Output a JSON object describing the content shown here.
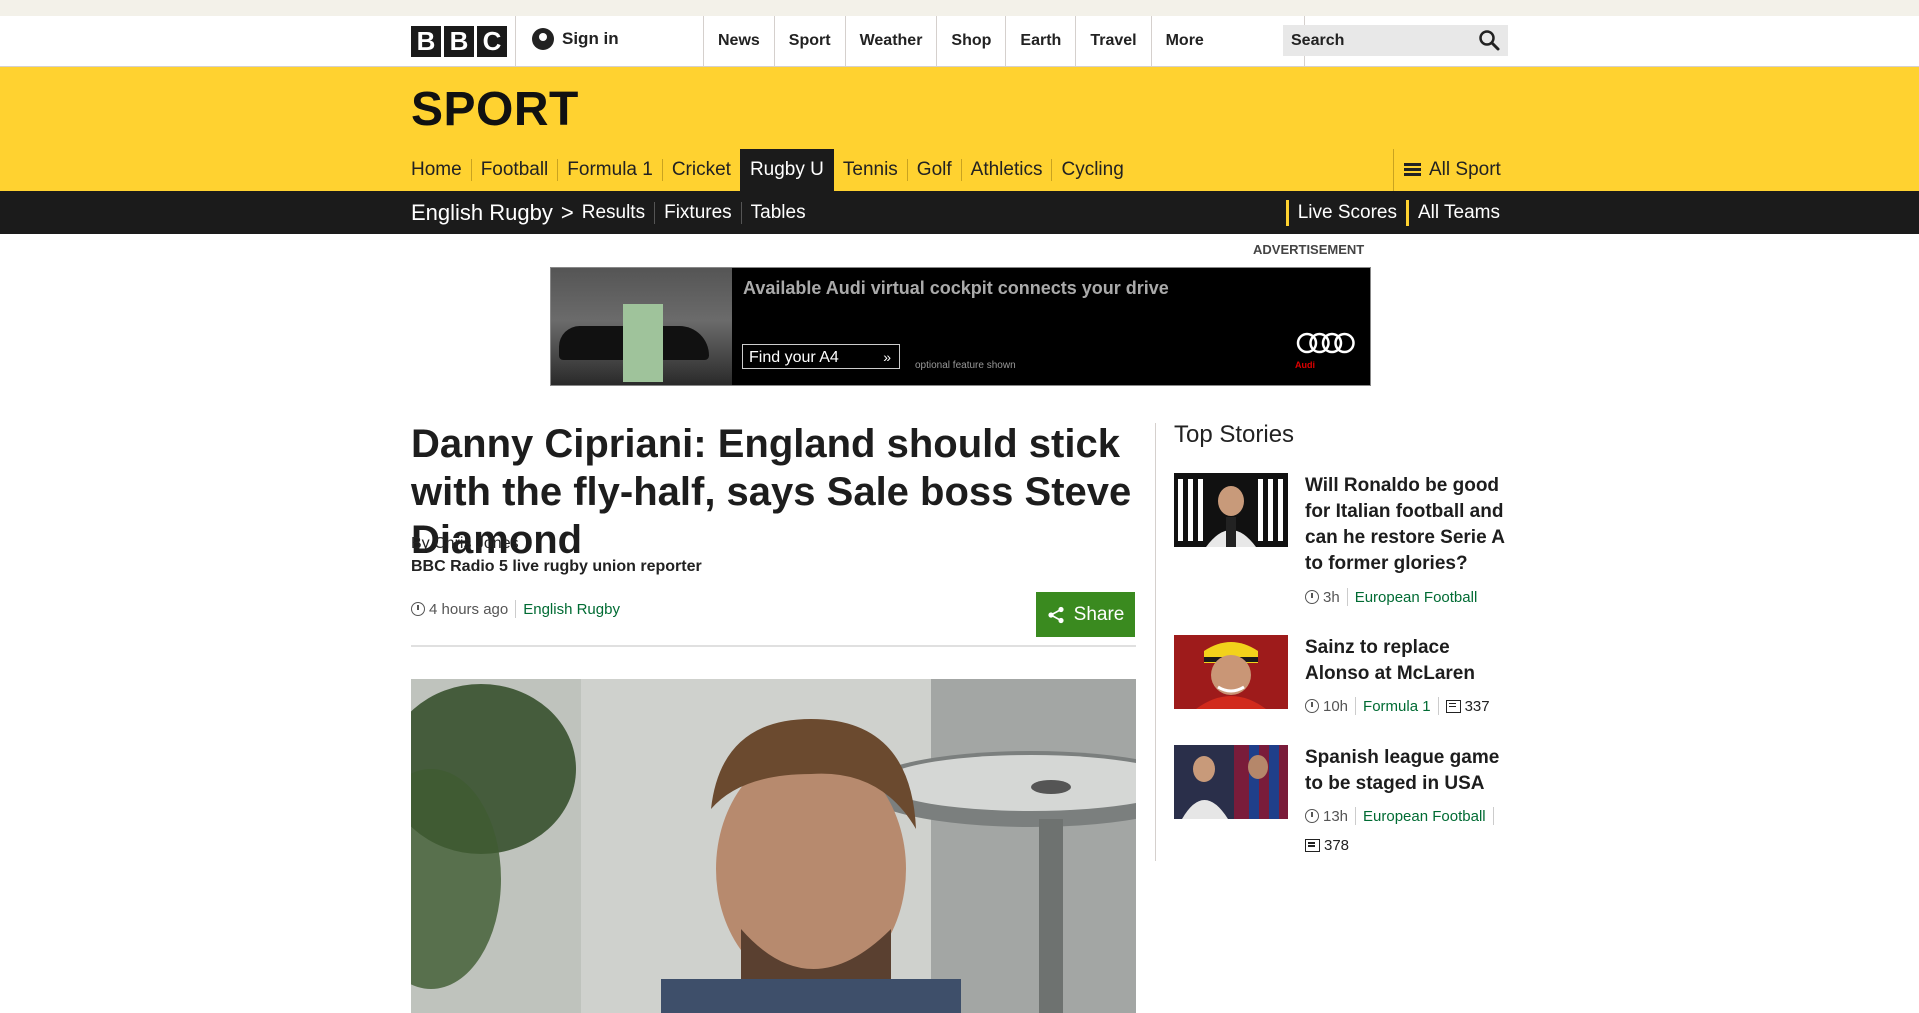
{
  "masthead": {
    "logo": [
      "B",
      "B",
      "C"
    ],
    "signin_label": "Sign in",
    "nav": [
      "News",
      "Sport",
      "Weather",
      "Shop",
      "Earth",
      "Travel"
    ],
    "more_label": "More",
    "search_placeholder": "Search"
  },
  "sport": {
    "title": "SPORT",
    "nav": [
      "Home",
      "Football",
      "Formula 1",
      "Cricket",
      "Rugby U",
      "Tennis",
      "Golf",
      "Athletics",
      "Cycling"
    ],
    "active_nav": "Rugby U",
    "all_sport_label": "All Sport"
  },
  "subnav": {
    "section": "English Rugby",
    "arrow": ">",
    "items": [
      "Results",
      "Fixtures",
      "Tables"
    ],
    "right_items": [
      "Live Scores",
      "All Teams"
    ]
  },
  "advert": {
    "label": "ADVERTISEMENT",
    "headline": "Available Audi virtual cockpit connects your drive",
    "cta": "Find your A4",
    "cta_arrow": "»",
    "note": "optional feature shown",
    "brand": "Audi"
  },
  "article": {
    "headline": "Danny Cipriani: England should stick with the fly-half, says Sale boss Steve Diamond",
    "byline": "By Chris Jones",
    "role": "BBC Radio 5 live rugby union reporter",
    "time": "4 hours ago",
    "section_link": "English Rugby",
    "share_label": "Share"
  },
  "sidebar": {
    "title": "Top Stories",
    "stories": [
      {
        "title": "Will Ronaldo be good for Italian football and can he restore Serie A to former glories?",
        "time": "3h",
        "section": "European Football",
        "comments": ""
      },
      {
        "title": "Sainz to replace Alonso at McLaren",
        "time": "10h",
        "section": "Formula 1",
        "comments": "337"
      },
      {
        "title": "Spanish league game to be staged in USA",
        "time": "13h",
        "section": "European Football",
        "comments": "378"
      }
    ]
  },
  "colors": {
    "sport_yellow": "#ffd230",
    "subnav_black": "#1b1b1b",
    "share_green": "#3a8a1f",
    "link_green": "#006b33"
  }
}
